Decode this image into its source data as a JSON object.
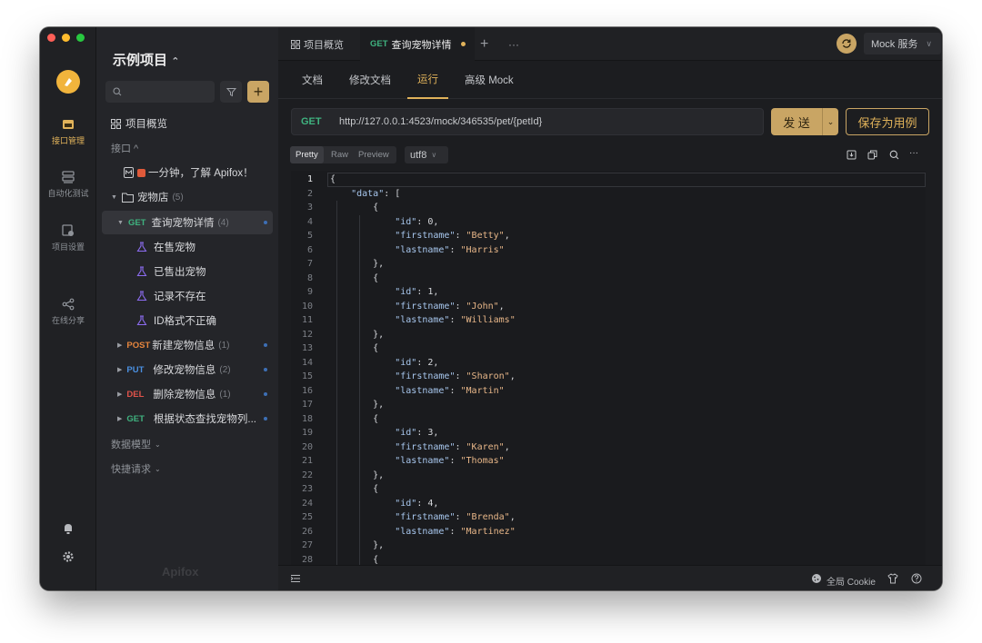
{
  "app": {
    "project_name": "示例项目",
    "watermark": "Apifox"
  },
  "rail": [
    {
      "label": "接口管理",
      "icon": "api-icon",
      "active": true
    },
    {
      "label": "自动化测试",
      "icon": "automation-icon",
      "active": false
    },
    {
      "label": "项目设置",
      "icon": "settings-icon",
      "active": false
    },
    {
      "label": "在线分享",
      "icon": "share-icon",
      "active": false
    }
  ],
  "sidebar": {
    "search_placeholder": "",
    "overview": "项目概览",
    "api_section": "接口 ^",
    "intro_doc": "一分钟，了解 Apifox！",
    "folder": {
      "name": "宠物店",
      "count": "(5)"
    },
    "selected_api": {
      "method": "GET",
      "name": "查询宠物详情",
      "count": "(4)"
    },
    "cases": [
      "在售宠物",
      "已售出宠物",
      "记录不存在",
      "ID格式不正确"
    ],
    "apis": [
      {
        "method": "POST",
        "name": "新建宠物信息",
        "count": "(1)"
      },
      {
        "method": "PUT",
        "name": "修改宠物信息",
        "count": "(2)"
      },
      {
        "method": "DEL",
        "name": "删除宠物信息",
        "count": "(1)"
      },
      {
        "method": "GET",
        "name": "根据状态查找宠物列...",
        "count": ""
      }
    ],
    "data_models": "数据模型",
    "quick_requests": "快捷请求"
  },
  "titlebar": {
    "tab_overview": "项目概览",
    "tab_active_method": "GET",
    "tab_active_name": "查询宠物详情",
    "mock_service": "Mock 服务"
  },
  "subtabs": [
    "文档",
    "修改文档",
    "运行",
    "高级 Mock"
  ],
  "request": {
    "method": "GET",
    "url": "http://127.0.0.1:4523/mock/346535/pet/{petId}",
    "send": "发 送",
    "save_case": "保存为用例"
  },
  "response": {
    "formats": [
      "Pretty",
      "Raw",
      "Preview"
    ],
    "encoding": "utf8"
  },
  "code": {
    "people": [
      {
        "id": "0",
        "firstname": "Betty",
        "lastname": "Harris"
      },
      {
        "id": "1",
        "firstname": "John",
        "lastname": "Williams"
      },
      {
        "id": "2",
        "firstname": "Sharon",
        "lastname": "Martin"
      },
      {
        "id": "3",
        "firstname": "Karen",
        "lastname": "Thomas"
      },
      {
        "id": "4",
        "firstname": "Brenda",
        "lastname": "Martinez"
      }
    ],
    "line_count": 28
  },
  "footer": {
    "cookie": "全局 Cookie"
  },
  "colors": {
    "accent": "#c9a564",
    "get": "#3fb27f",
    "post": "#e5853d",
    "put": "#4a8fe0",
    "del": "#e0534a",
    "key": "#a8c7ee",
    "string": "#e7b688"
  }
}
